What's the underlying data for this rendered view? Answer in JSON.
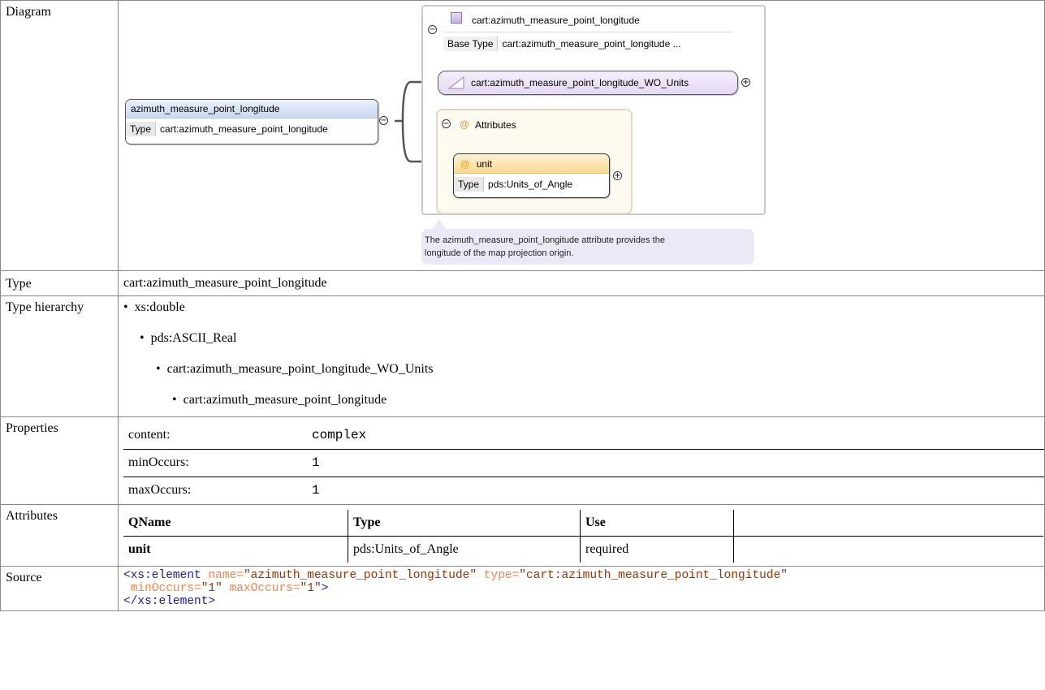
{
  "rows": {
    "diagram_label": "Diagram",
    "type_label": "Type",
    "hierarchy_label": "Type hierarchy",
    "properties_label": "Properties",
    "attributes_label": "Attributes",
    "source_label": "Source"
  },
  "diagram": {
    "element": {
      "name": "azimuth_measure_point_longitude",
      "type_key": "Type",
      "type_value": "cart:azimuth_measure_point_longitude"
    },
    "complex_type": {
      "name": "cart:azimuth_measure_point_longitude",
      "base_key": "Base Type",
      "base_value": "cart:azimuth_measure_point_longitude ..."
    },
    "simple_type": {
      "name": "cart:azimuth_measure_point_longitude_WO_Units"
    },
    "attributes_group": {
      "title": "Attributes"
    },
    "attribute": {
      "name": "unit",
      "type_key": "Type",
      "type_value": "pds:Units_of_Angle"
    },
    "annotation": {
      "line1": "The azimuth_measure_point_longitude attribute provides the",
      "line2": "longitude of the map projection origin."
    }
  },
  "type_value": "cart:azimuth_measure_point_longitude",
  "hierarchy": [
    "xs:double",
    "pds:ASCII_Real",
    "cart:azimuth_measure_point_longitude_WO_Units",
    "cart:azimuth_measure_point_longitude"
  ],
  "properties": [
    {
      "key": "content:",
      "value": "complex"
    },
    {
      "key": "minOccurs:",
      "value": "1"
    },
    {
      "key": "maxOccurs:",
      "value": "1"
    }
  ],
  "attributes_table": {
    "headers": [
      "QName",
      "Type",
      "Use",
      ""
    ],
    "rows": [
      [
        "unit",
        "pds:Units_of_Angle",
        "required",
        ""
      ]
    ]
  },
  "source": {
    "open_tag": "<xs:element",
    "attr1_name": "name=",
    "attr1_value": "\"azimuth_measure_point_longitude\"",
    "attr2_name": "type=",
    "attr2_value": "\"cart:azimuth_measure_point_longitude\"",
    "attr3_name": "minOccurs=",
    "attr3_value": "\"1\"",
    "attr4_name": "maxOccurs=",
    "attr4_value": "\"1\"",
    "open_end": ">",
    "close_tag": "</xs:element>"
  }
}
